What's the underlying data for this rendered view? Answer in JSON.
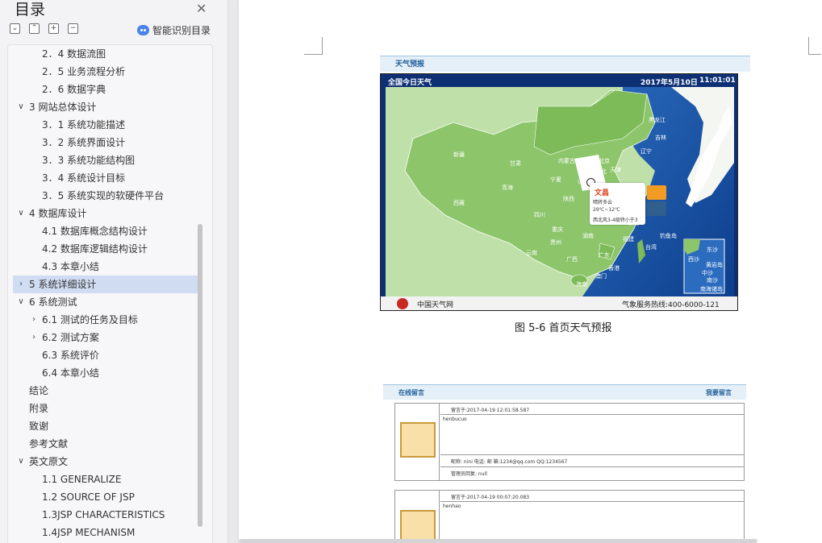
{
  "toc": {
    "title": "目录",
    "smart_label": "智能识别目录",
    "toolbar_icons": [
      "expand-all-icon",
      "collapse-all-icon",
      "add-heading-icon",
      "remove-heading-icon"
    ],
    "items": [
      {
        "arrow": "",
        "indent": 2,
        "text": "2．4  数据流图",
        "active": false
      },
      {
        "arrow": "",
        "indent": 2,
        "text": "2．5  业务流程分析",
        "active": false
      },
      {
        "arrow": "",
        "indent": 2,
        "text": "2．6  数据字典",
        "active": false
      },
      {
        "arrow": "v",
        "indent": 1,
        "text": "3    网站总体设计",
        "active": false
      },
      {
        "arrow": "",
        "indent": 2,
        "text": "3．1 系统功能描述",
        "active": false
      },
      {
        "arrow": "",
        "indent": 2,
        "text": "3．2 系统界面设计",
        "active": false
      },
      {
        "arrow": "",
        "indent": 2,
        "text": "3．3 系统功能结构图",
        "active": false
      },
      {
        "arrow": "",
        "indent": 2,
        "text": "3．4 系统设计目标",
        "active": false
      },
      {
        "arrow": "",
        "indent": 2,
        "text": "3．5 系统实现的软硬件平台",
        "active": false
      },
      {
        "arrow": "v",
        "indent": 1,
        "text": "4    数据库设计",
        "active": false
      },
      {
        "arrow": "",
        "indent": 2,
        "text": "4.1 数据库概念结构设计",
        "active": false
      },
      {
        "arrow": "",
        "indent": 2,
        "text": "4.2 数据库逻辑结构设计",
        "active": false
      },
      {
        "arrow": "",
        "indent": 2,
        "text": "4.3 本章小结",
        "active": false
      },
      {
        "arrow": ">",
        "indent": 1,
        "text": "5    系统详细设计",
        "active": true
      },
      {
        "arrow": "v",
        "indent": 1,
        "text": "6    系统测试",
        "active": false
      },
      {
        "arrow": ">",
        "indent": 2,
        "text": "6.1  测试的任务及目标",
        "active": false
      },
      {
        "arrow": ">",
        "indent": 2,
        "text": "6.2 测试方案",
        "active": false
      },
      {
        "arrow": "",
        "indent": 2,
        "text": "6.3 系统评价",
        "active": false
      },
      {
        "arrow": "",
        "indent": 2,
        "text": "6.4 本章小结",
        "active": false
      },
      {
        "arrow": "",
        "indent": 1,
        "text": "结论",
        "active": false
      },
      {
        "arrow": "",
        "indent": 1,
        "text": "附录",
        "active": false
      },
      {
        "arrow": "",
        "indent": 1,
        "text": "致谢",
        "active": false
      },
      {
        "arrow": "",
        "indent": 1,
        "text": "参考文献",
        "active": false
      },
      {
        "arrow": "v",
        "indent": 1,
        "text": "英文原文",
        "active": false
      },
      {
        "arrow": "",
        "indent": 2,
        "text": "1.1 GENERALIZE",
        "active": false
      },
      {
        "arrow": "",
        "indent": 2,
        "text": "1.2 SOURCE OF JSP",
        "active": false
      },
      {
        "arrow": "",
        "indent": 2,
        "text": "1.3JSP CHARACTERISTICS",
        "active": false
      },
      {
        "arrow": "",
        "indent": 2,
        "text": "1.4JSP MECHANISM",
        "active": false
      }
    ]
  },
  "weather_figure": {
    "header_label": "天气预报",
    "bar_title": "全国今日天气",
    "bar_date": "2017年5月10日",
    "bar_time": "11:01:01",
    "footer_logo_text": "中国天气网",
    "footer_hotline": "气象服务热线:400-6000-121",
    "popup": {
      "city": "文昌",
      "condition": "晴转多云",
      "temp": "29℃~12℃",
      "wind": "西北风3-4级转小于3"
    },
    "provinces": [
      {
        "name": "黑龙江",
        "pos": "p1"
      },
      {
        "name": "吉林",
        "pos": "p2"
      },
      {
        "name": "辽宁",
        "pos": "p3"
      },
      {
        "name": "新疆",
        "pos": "p4"
      },
      {
        "name": "甘肃",
        "pos": "p5"
      },
      {
        "name": "内蒙古",
        "pos": "p6"
      },
      {
        "name": "北京",
        "pos": "p7"
      },
      {
        "name": "天津",
        "pos": "p8"
      },
      {
        "name": "河北",
        "pos": "p9"
      },
      {
        "name": "宁夏",
        "pos": "p10"
      },
      {
        "name": "山西",
        "pos": "p11"
      },
      {
        "name": "青海",
        "pos": "p12"
      },
      {
        "name": "陕西",
        "pos": "p13"
      },
      {
        "name": "西藏",
        "pos": "p14"
      },
      {
        "name": "四川",
        "pos": "p15"
      },
      {
        "name": "重庆",
        "pos": "p16"
      },
      {
        "name": "湖北",
        "pos": "p17"
      },
      {
        "name": "湖南",
        "pos": "p18"
      },
      {
        "name": "贵州",
        "pos": "p19"
      },
      {
        "name": "云南",
        "pos": "p20"
      },
      {
        "name": "广西",
        "pos": "p21"
      },
      {
        "name": "广东",
        "pos": "p22"
      },
      {
        "name": "福建",
        "pos": "p23"
      },
      {
        "name": "浙江",
        "pos": "p24"
      },
      {
        "name": "台湾",
        "pos": "p25"
      },
      {
        "name": "钓鱼岛",
        "pos": "p26"
      },
      {
        "name": "香港",
        "pos": "p27"
      },
      {
        "name": "澳门",
        "pos": "p28"
      },
      {
        "name": "海南",
        "pos": "p29"
      }
    ],
    "south_sea_labels": [
      "东沙",
      "西沙",
      "黄岩岛",
      "中沙",
      "南沙",
      "南海诸岛"
    ]
  },
  "caption": "图 5-6 首页天气预报",
  "message_figure": {
    "header_left": "在线留言",
    "header_right": "我要留言",
    "cards": [
      {
        "time": "留言于:2017-04-19 12:01:58.587",
        "content": "henbucuo",
        "contact": "昵称: nini      电话:    邮 箱:1234@qq.com      QQ:1234567",
        "reply": "管理员回复: null"
      },
      {
        "time": "留言于:2017-04-19 00:07:20.083",
        "content": "henhao",
        "contact": "",
        "reply": ""
      }
    ]
  }
}
